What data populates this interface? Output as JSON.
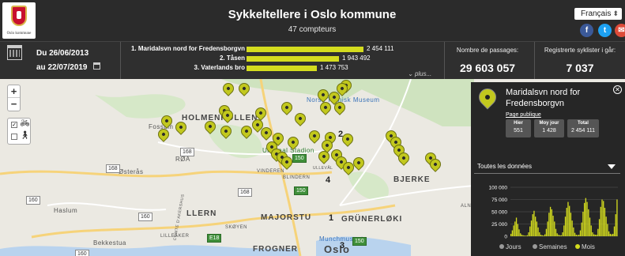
{
  "header": {
    "logo_text": "Oslo kommune",
    "title": "Sykkeltellere i Oslo kommune",
    "subtitle": "47 compteurs",
    "language": "Français",
    "social": [
      "facebook",
      "twitter",
      "email"
    ]
  },
  "stats": {
    "date_from": "Du 26/06/2013",
    "date_to": "au 22/07/2019",
    "ranking": [
      {
        "label": "1. Maridalsvn nord for Fredensborgvn",
        "value": "2 454 111",
        "raw": 2454111
      },
      {
        "label": "2. Tåsen",
        "value": "1 943 492",
        "raw": 1943492
      },
      {
        "label": "3. Vaterlands bro",
        "value": "1 473 753",
        "raw": 1473753
      }
    ],
    "more_label": "plus...",
    "passages_label": "Nombre de passages:",
    "passages_value": "29 603 057",
    "yesterday_label": "Registrerte syklister i går:",
    "yesterday_value": "7 037"
  },
  "map": {
    "labels": {
      "holmenkollen": "HOLMENKOLLEN",
      "fossum": "Fossum",
      "roa": "RØA",
      "osteras": "Østerås",
      "haslum": "Haslum",
      "bekkestua": "Bekkestua",
      "ullern": "LLERN",
      "skoyen": "SKØYEN",
      "lilleaker": "LILLEAKER",
      "frogner": "FROGNER",
      "oslo": "Oslo",
      "bjerke": "BJERKE",
      "grunerlokka": "GRÜNERLØKI",
      "vinderen": "VINDEREN",
      "blindern": "BLINDERN",
      "ullevaal": "Ullevaal Stadion",
      "museum": "Norsk Teknisk Museum",
      "majorstua": "MAJORSTU",
      "munch": "Munchmuseet",
      "comte": "COMTE D'AKERSHUS",
      "ullevaal_short": "ULLEVÅL",
      "alna": "ALNA"
    },
    "road_badges": [
      "168",
      "168",
      "168",
      "160",
      "160",
      "160",
      "150",
      "150",
      "150",
      "E18"
    ],
    "cluster_numbers": [
      "2",
      "4",
      "1",
      "3"
    ],
    "layers": [
      "bike",
      "pedestrian"
    ]
  },
  "panel": {
    "title": "Maridalsvn nord for Fredensborgvn",
    "public_link": "Page publique",
    "cards": [
      {
        "label": "Hier",
        "value": "551"
      },
      {
        "label": "Moy jour",
        "value": "1 428"
      },
      {
        "label": "Total",
        "value": "2 454 111"
      }
    ],
    "select": "Toutes les données",
    "legend": [
      {
        "label": "Jours",
        "color": "#9a9a9a"
      },
      {
        "label": "Semaines",
        "color": "#9a9a9a"
      },
      {
        "label": "Mois",
        "color": "#d4dc1e"
      }
    ]
  },
  "chart_data": {
    "type": "bar",
    "ylim": [
      0,
      100000
    ],
    "ytick_labels": [
      "100 000",
      "75 000",
      "50 000",
      "25 000",
      "0"
    ],
    "yticks": [
      100000,
      75000,
      50000,
      25000,
      0
    ],
    "series": [
      {
        "values": [
          5000,
          12000,
          22000,
          30000,
          38000,
          25000,
          14000,
          6000,
          3000,
          2000,
          1500,
          1000,
          2000,
          8000,
          20000,
          32000,
          45000,
          52000,
          40000,
          30000,
          18000,
          8000,
          3000,
          2000,
          1500,
          4000,
          15000,
          30000,
          48000,
          60000,
          55000,
          42000,
          30000,
          15000,
          6000,
          3000,
          2000,
          2000,
          8000,
          22000,
          40000,
          58000,
          70000,
          62000,
          48000,
          32000,
          18000,
          7000,
          3000,
          2500,
          3000,
          12000,
          28000,
          50000,
          68000,
          78000,
          70000,
          55000,
          38000,
          22000,
          8000,
          4000,
          3000,
          3000,
          15000,
          35000,
          60000,
          75000,
          72000,
          58000,
          40000,
          25000,
          10000,
          5000,
          4000,
          5000,
          20000,
          45000,
          75000
        ]
      }
    ]
  }
}
